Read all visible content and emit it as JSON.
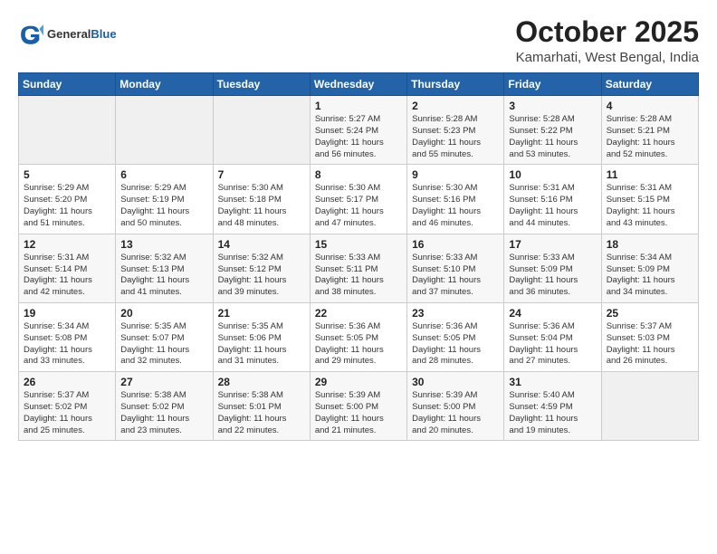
{
  "branding": {
    "general": "General",
    "blue": "Blue"
  },
  "header": {
    "title": "October 2025",
    "location": "Kamarhati, West Bengal, India"
  },
  "columns": [
    "Sunday",
    "Monday",
    "Tuesday",
    "Wednesday",
    "Thursday",
    "Friday",
    "Saturday"
  ],
  "weeks": [
    [
      {
        "day": "",
        "info": ""
      },
      {
        "day": "",
        "info": ""
      },
      {
        "day": "",
        "info": ""
      },
      {
        "day": "1",
        "info": "Sunrise: 5:27 AM\nSunset: 5:24 PM\nDaylight: 11 hours\nand 56 minutes."
      },
      {
        "day": "2",
        "info": "Sunrise: 5:28 AM\nSunset: 5:23 PM\nDaylight: 11 hours\nand 55 minutes."
      },
      {
        "day": "3",
        "info": "Sunrise: 5:28 AM\nSunset: 5:22 PM\nDaylight: 11 hours\nand 53 minutes."
      },
      {
        "day": "4",
        "info": "Sunrise: 5:28 AM\nSunset: 5:21 PM\nDaylight: 11 hours\nand 52 minutes."
      }
    ],
    [
      {
        "day": "5",
        "info": "Sunrise: 5:29 AM\nSunset: 5:20 PM\nDaylight: 11 hours\nand 51 minutes."
      },
      {
        "day": "6",
        "info": "Sunrise: 5:29 AM\nSunset: 5:19 PM\nDaylight: 11 hours\nand 50 minutes."
      },
      {
        "day": "7",
        "info": "Sunrise: 5:30 AM\nSunset: 5:18 PM\nDaylight: 11 hours\nand 48 minutes."
      },
      {
        "day": "8",
        "info": "Sunrise: 5:30 AM\nSunset: 5:17 PM\nDaylight: 11 hours\nand 47 minutes."
      },
      {
        "day": "9",
        "info": "Sunrise: 5:30 AM\nSunset: 5:16 PM\nDaylight: 11 hours\nand 46 minutes."
      },
      {
        "day": "10",
        "info": "Sunrise: 5:31 AM\nSunset: 5:16 PM\nDaylight: 11 hours\nand 44 minutes."
      },
      {
        "day": "11",
        "info": "Sunrise: 5:31 AM\nSunset: 5:15 PM\nDaylight: 11 hours\nand 43 minutes."
      }
    ],
    [
      {
        "day": "12",
        "info": "Sunrise: 5:31 AM\nSunset: 5:14 PM\nDaylight: 11 hours\nand 42 minutes."
      },
      {
        "day": "13",
        "info": "Sunrise: 5:32 AM\nSunset: 5:13 PM\nDaylight: 11 hours\nand 41 minutes."
      },
      {
        "day": "14",
        "info": "Sunrise: 5:32 AM\nSunset: 5:12 PM\nDaylight: 11 hours\nand 39 minutes."
      },
      {
        "day": "15",
        "info": "Sunrise: 5:33 AM\nSunset: 5:11 PM\nDaylight: 11 hours\nand 38 minutes."
      },
      {
        "day": "16",
        "info": "Sunrise: 5:33 AM\nSunset: 5:10 PM\nDaylight: 11 hours\nand 37 minutes."
      },
      {
        "day": "17",
        "info": "Sunrise: 5:33 AM\nSunset: 5:09 PM\nDaylight: 11 hours\nand 36 minutes."
      },
      {
        "day": "18",
        "info": "Sunrise: 5:34 AM\nSunset: 5:09 PM\nDaylight: 11 hours\nand 34 minutes."
      }
    ],
    [
      {
        "day": "19",
        "info": "Sunrise: 5:34 AM\nSunset: 5:08 PM\nDaylight: 11 hours\nand 33 minutes."
      },
      {
        "day": "20",
        "info": "Sunrise: 5:35 AM\nSunset: 5:07 PM\nDaylight: 11 hours\nand 32 minutes."
      },
      {
        "day": "21",
        "info": "Sunrise: 5:35 AM\nSunset: 5:06 PM\nDaylight: 11 hours\nand 31 minutes."
      },
      {
        "day": "22",
        "info": "Sunrise: 5:36 AM\nSunset: 5:05 PM\nDaylight: 11 hours\nand 29 minutes."
      },
      {
        "day": "23",
        "info": "Sunrise: 5:36 AM\nSunset: 5:05 PM\nDaylight: 11 hours\nand 28 minutes."
      },
      {
        "day": "24",
        "info": "Sunrise: 5:36 AM\nSunset: 5:04 PM\nDaylight: 11 hours\nand 27 minutes."
      },
      {
        "day": "25",
        "info": "Sunrise: 5:37 AM\nSunset: 5:03 PM\nDaylight: 11 hours\nand 26 minutes."
      }
    ],
    [
      {
        "day": "26",
        "info": "Sunrise: 5:37 AM\nSunset: 5:02 PM\nDaylight: 11 hours\nand 25 minutes."
      },
      {
        "day": "27",
        "info": "Sunrise: 5:38 AM\nSunset: 5:02 PM\nDaylight: 11 hours\nand 23 minutes."
      },
      {
        "day": "28",
        "info": "Sunrise: 5:38 AM\nSunset: 5:01 PM\nDaylight: 11 hours\nand 22 minutes."
      },
      {
        "day": "29",
        "info": "Sunrise: 5:39 AM\nSunset: 5:00 PM\nDaylight: 11 hours\nand 21 minutes."
      },
      {
        "day": "30",
        "info": "Sunrise: 5:39 AM\nSunset: 5:00 PM\nDaylight: 11 hours\nand 20 minutes."
      },
      {
        "day": "31",
        "info": "Sunrise: 5:40 AM\nSunset: 4:59 PM\nDaylight: 11 hours\nand 19 minutes."
      },
      {
        "day": "",
        "info": ""
      }
    ]
  ]
}
